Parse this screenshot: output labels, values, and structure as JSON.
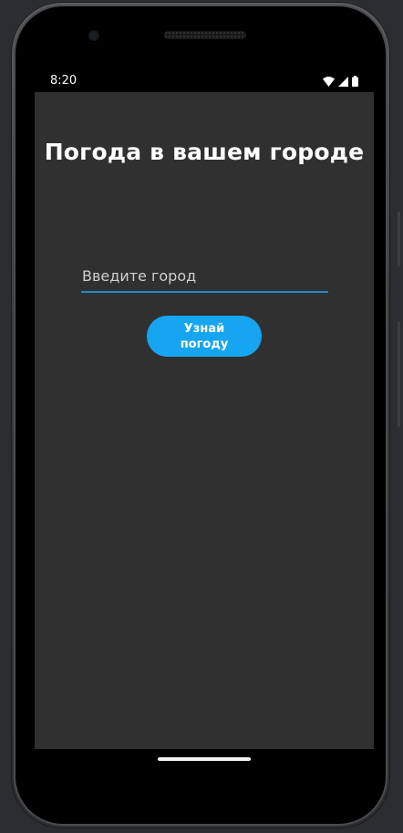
{
  "status_bar": {
    "time": "8:20",
    "icons": [
      "wifi-icon",
      "cellular-signal-icon",
      "battery-icon"
    ]
  },
  "main": {
    "title": "Погода в вашем городе",
    "city_input": {
      "placeholder": "Введите город",
      "value": ""
    },
    "submit_button": {
      "label": "Узнай погоду"
    }
  },
  "colors": {
    "screen_background": "#303030",
    "accent": "#16a5f0",
    "input_underline": "#1e88c8",
    "title_text": "#ffffff"
  }
}
